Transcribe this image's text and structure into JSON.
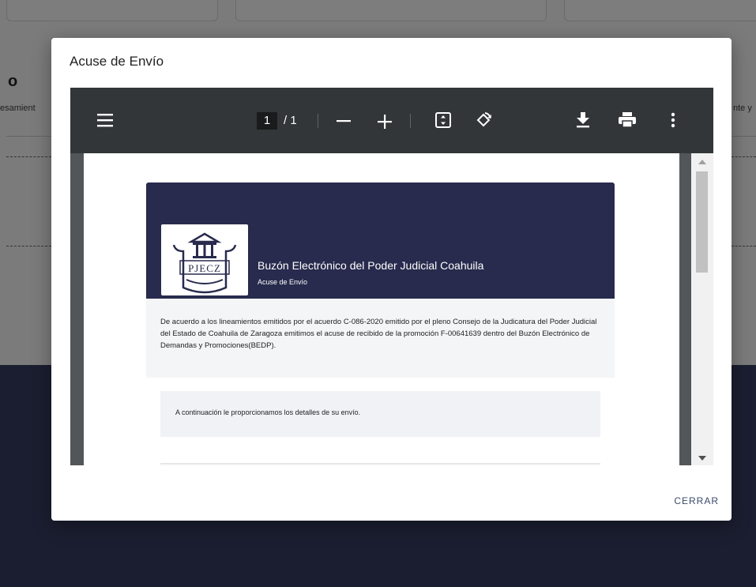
{
  "background": {
    "heading_fragment": "o",
    "left_text_fragment": "esamient",
    "right_text_fragment": "nte y"
  },
  "modal": {
    "title": "Acuse de Envío",
    "close_label": "CERRAR"
  },
  "viewer": {
    "current_page": "1",
    "page_total": "/ 1",
    "icons": [
      "menu-icon",
      "zoom-out-icon",
      "zoom-in-icon",
      "fit-page-icon",
      "rotate-icon",
      "download-icon",
      "print-icon",
      "more-options-icon"
    ]
  },
  "document": {
    "logo_text": "PJECZ",
    "header_title": "Buzón Electrónico del Poder Judicial Coahuila",
    "header_subtitle": "Acuse de Envío",
    "intro_text": "De acuerdo a los lineamientos emitidos por el acuerdo C-086-2020 emitido por el pleno Consejo de la Judicatura del Poder Judicial del Estado de Coahuila de Zaragoza emitimos el acuse de recibido de la promoción F-00641639 dentro del Buzón Electrónico de Demandas y Promociones(BEDP).",
    "details_text": "A continuación le proporcionamos los detalles de su envío."
  },
  "colors": {
    "header_bg": "#282b4d",
    "toolbar_bg": "#323639",
    "page_footer_bg": "#1b1e30"
  }
}
